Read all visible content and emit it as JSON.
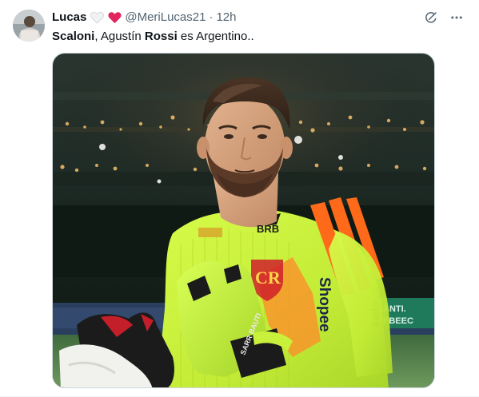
{
  "tweet": {
    "display_name": "Lucas",
    "name_emojis": [
      "white-heart-icon",
      "red-heart-icon"
    ],
    "handle": "@MeriLucas21",
    "separator": "·",
    "timestamp": "12h",
    "text": {
      "bold1": "Scaloni",
      "plain1": ", Agustín ",
      "bold2": "Rossi",
      "plain2": " es Argentino.."
    }
  },
  "actions": {
    "icons": [
      "grok-icon",
      "more-options-icon"
    ]
  },
  "media": {
    "jersey_sponsor": "Shopee",
    "chest_sponsor": "BRB",
    "glove_text": "SARR BAUTI"
  },
  "colors": {
    "text_primary": "#0f1419",
    "text_secondary": "#536471",
    "heart_red": "#e0245e",
    "jersey_yellow": "#c8f03c",
    "jersey_orange": "#ff6a1a"
  }
}
